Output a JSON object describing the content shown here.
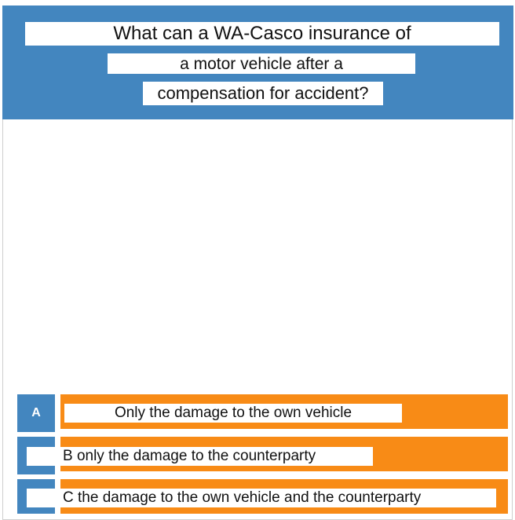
{
  "question": {
    "line1": "What can a WA-Casco insurance of",
    "line2": "a motor vehicle after a",
    "line3": "compensation for accident?"
  },
  "answers": [
    {
      "letter": "A",
      "text": "Only the damage to the own vehicle"
    },
    {
      "text": "B only the damage to the counterparty"
    },
    {
      "text": "C the damage to the own vehicle and the counterparty"
    }
  ],
  "colors": {
    "question_bg": "#4386bf",
    "answer_bg": "#f88b16",
    "letter_bg": "#4386bf"
  }
}
